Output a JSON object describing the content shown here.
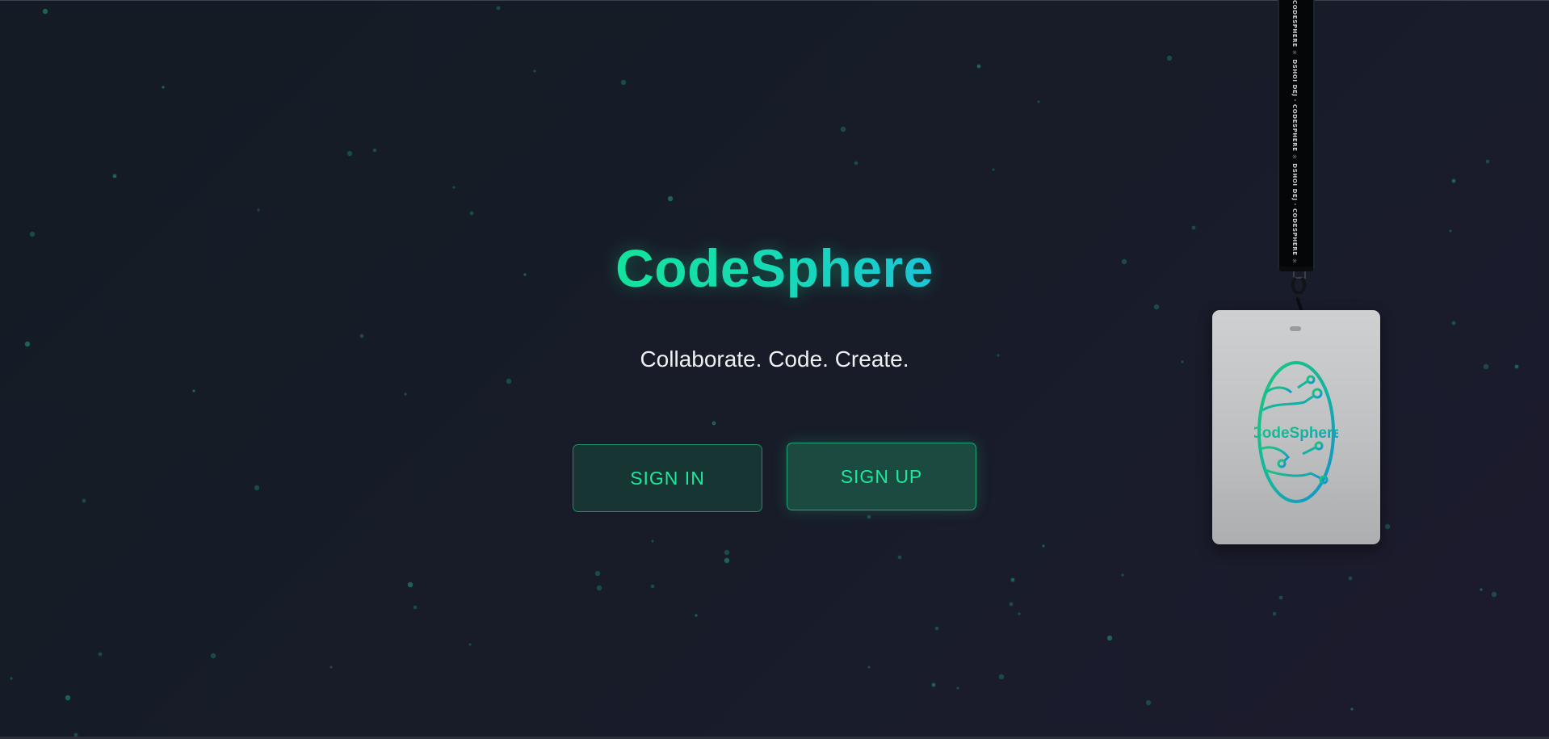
{
  "hero": {
    "title": "CodeSphere",
    "tagline": "Collaborate. Code. Create."
  },
  "actions": {
    "sign_in_label": "SIGN IN",
    "sign_up_label": "SIGN UP"
  },
  "lanyard": {
    "strap_text": "CODESPHERE ☼ DSHOI DEJ · CODESPHERE ☼ DSHOI DEJ · CODESPHERE ☼ DSHOI DEJ · CODESPHERE ☼ DSHOI DEJ",
    "badge_logo_text": "CodeSphere"
  },
  "colors": {
    "background": "#161b26",
    "accent_green": "#13e39b",
    "accent_cyan": "#1cc4d8",
    "button_text": "#1ee89c",
    "star": "#1e6b5a"
  }
}
